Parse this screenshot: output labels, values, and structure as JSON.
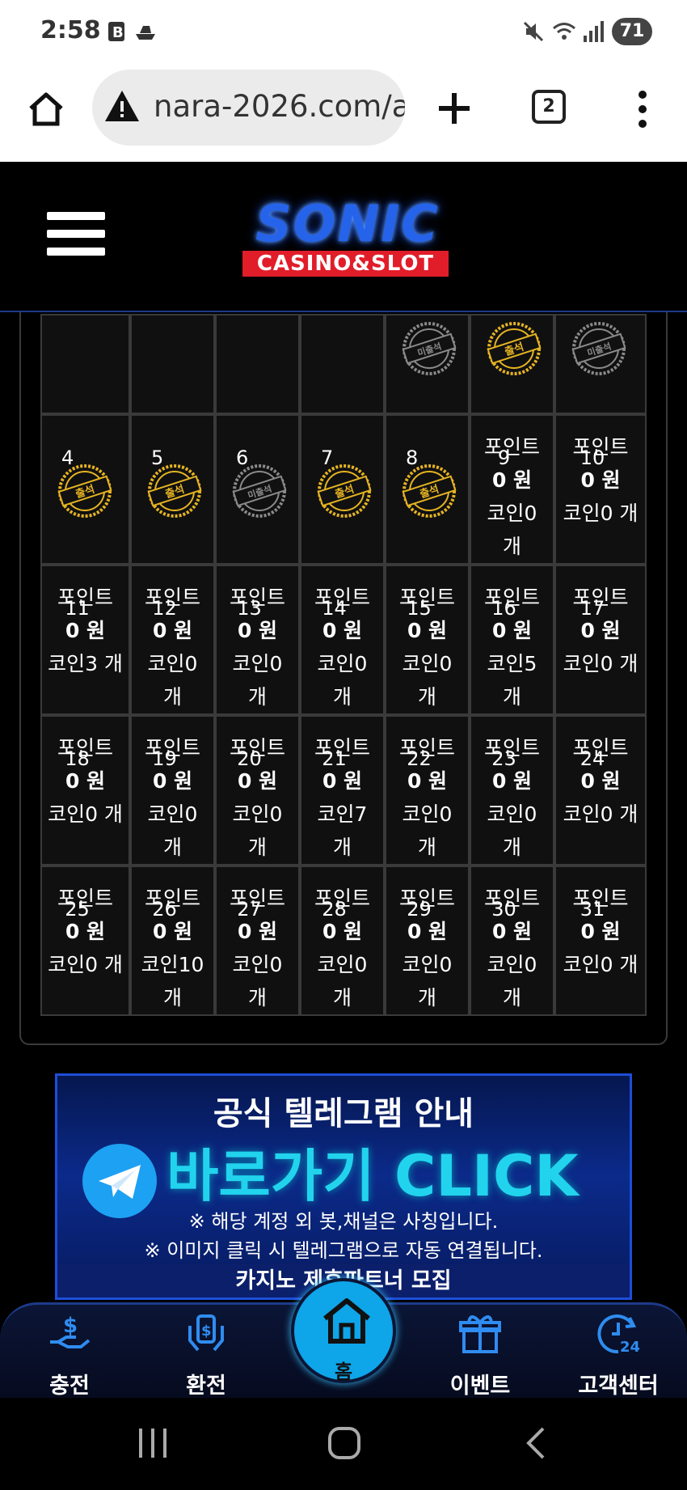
{
  "status_bar": {
    "time": "2:58",
    "battery": "71"
  },
  "browser": {
    "url": "nara-2026.com/a",
    "tab_count": "2"
  },
  "site": {
    "logo_main": "SONIC",
    "logo_sub": "CASINO&SLOT"
  },
  "calendar": {
    "stamps": {
      "attended": "출석",
      "absent": "미출석"
    },
    "top_row": [
      {
        "stamp": null
      },
      {
        "stamp": null
      },
      {
        "stamp": null
      },
      {
        "stamp": null
      },
      {
        "stamp": "absent"
      },
      {
        "stamp": "attended"
      },
      {
        "stamp": "absent"
      }
    ],
    "rows": [
      [
        {
          "day": "4",
          "stamp": "attended"
        },
        {
          "day": "5",
          "stamp": "attended"
        },
        {
          "day": "6",
          "stamp": "absent"
        },
        {
          "day": "7",
          "stamp": "attended"
        },
        {
          "day": "8",
          "stamp": "attended"
        },
        {
          "day": "9",
          "line1": "포인트",
          "line2": "0 원",
          "line3": "코인0",
          "line4": "개"
        },
        {
          "day": "10",
          "line1": "포인트",
          "line2": "0 원",
          "line3": "코인0 개"
        }
      ],
      [
        {
          "day": "11",
          "line1": "포인트",
          "line2": "0 원",
          "line3": "코인3 개"
        },
        {
          "day": "12",
          "line1": "포인트",
          "line2": "0 원",
          "line3": "코인0",
          "line4": "개"
        },
        {
          "day": "13",
          "line1": "포인트",
          "line2": "0 원",
          "line3": "코인0",
          "line4": "개"
        },
        {
          "day": "14",
          "line1": "포인트",
          "line2": "0 원",
          "line3": "코인0",
          "line4": "개"
        },
        {
          "day": "15",
          "line1": "포인트",
          "line2": "0 원",
          "line3": "코인0",
          "line4": "개"
        },
        {
          "day": "16",
          "line1": "포인트",
          "line2": "0 원",
          "line3": "코인5",
          "line4": "개"
        },
        {
          "day": "17",
          "line1": "포인트",
          "line2": "0 원",
          "line3": "코인0 개"
        }
      ],
      [
        {
          "day": "18",
          "line1": "포인트",
          "line2": "0 원",
          "line3": "코인0 개"
        },
        {
          "day": "19",
          "line1": "포인트",
          "line2": "0 원",
          "line3": "코인0",
          "line4": "개"
        },
        {
          "day": "20",
          "line1": "포인트",
          "line2": "0 원",
          "line3": "코인0",
          "line4": "개"
        },
        {
          "day": "21",
          "line1": "포인트",
          "line2": "0 원",
          "line3": "코인7",
          "line4": "개"
        },
        {
          "day": "22",
          "line1": "포인트",
          "line2": "0 원",
          "line3": "코인0",
          "line4": "개"
        },
        {
          "day": "23",
          "line1": "포인트",
          "line2": "0 원",
          "line3": "코인0",
          "line4": "개"
        },
        {
          "day": "24",
          "line1": "포인트",
          "line2": "0 원",
          "line3": "코인0 개"
        }
      ],
      [
        {
          "day": "25",
          "line1": "포인트",
          "line2": "0 원",
          "line3": "코인0 개"
        },
        {
          "day": "26",
          "line1": "포인트",
          "line2": "0 원",
          "line3": "코인10",
          "line4": "개"
        },
        {
          "day": "27",
          "line1": "포인트",
          "line2": "0 원",
          "line3": "코인0",
          "line4": "개"
        },
        {
          "day": "28",
          "line1": "포인트",
          "line2": "0 원",
          "line3": "코인0",
          "line4": "개"
        },
        {
          "day": "29",
          "line1": "포인트",
          "line2": "0 원",
          "line3": "코인0",
          "line4": "개"
        },
        {
          "day": "30",
          "line1": "포인트",
          "line2": "0 원",
          "line3": "코인0",
          "line4": "개"
        },
        {
          "day": "31",
          "line1": "포인트",
          "line2": "0 원",
          "line3": "코인0 개"
        }
      ]
    ]
  },
  "banner": {
    "title": "공식 텔레그램 안내",
    "click": "바로가기 CLICK",
    "note1": "※ 해당 계정 외 봇,채널은 사칭입니다.",
    "note2": "※ 이미지 클릭 시 텔레그램으로 자동 연결됩니다.",
    "partner": "카지노 제휴파트너 모집"
  },
  "bottom_nav": {
    "deposit": "충전",
    "withdraw": "환전",
    "home": "홈",
    "event": "이벤트",
    "support": "고객센터"
  },
  "colors": {
    "accent": "#0ea5e9",
    "stamp_gold": "#e6b422",
    "stamp_gray": "#8a8a8a",
    "brand_red": "#e11d2a"
  }
}
